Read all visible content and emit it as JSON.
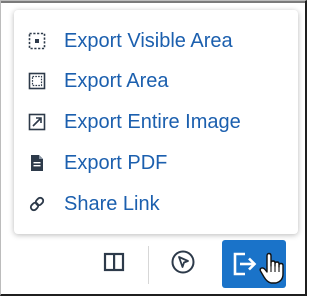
{
  "menu": {
    "items": [
      {
        "label": "Export Visible Area",
        "icon": "export-visible-area-icon"
      },
      {
        "label": "Export Area",
        "icon": "export-area-icon"
      },
      {
        "label": "Export Entire Image",
        "icon": "export-entire-image-icon"
      },
      {
        "label": "Export PDF",
        "icon": "pdf-file-icon"
      },
      {
        "label": "Share Link",
        "icon": "link-icon"
      }
    ]
  },
  "toolbar": {
    "buttons": [
      {
        "icon": "split-view-icon"
      },
      {
        "icon": "navigation-arrow-icon"
      },
      {
        "icon": "export-icon"
      }
    ]
  },
  "colors": {
    "link_text": "#1b5fae",
    "icon_dark": "#2d3a4a",
    "accent": "#1a73c9"
  }
}
